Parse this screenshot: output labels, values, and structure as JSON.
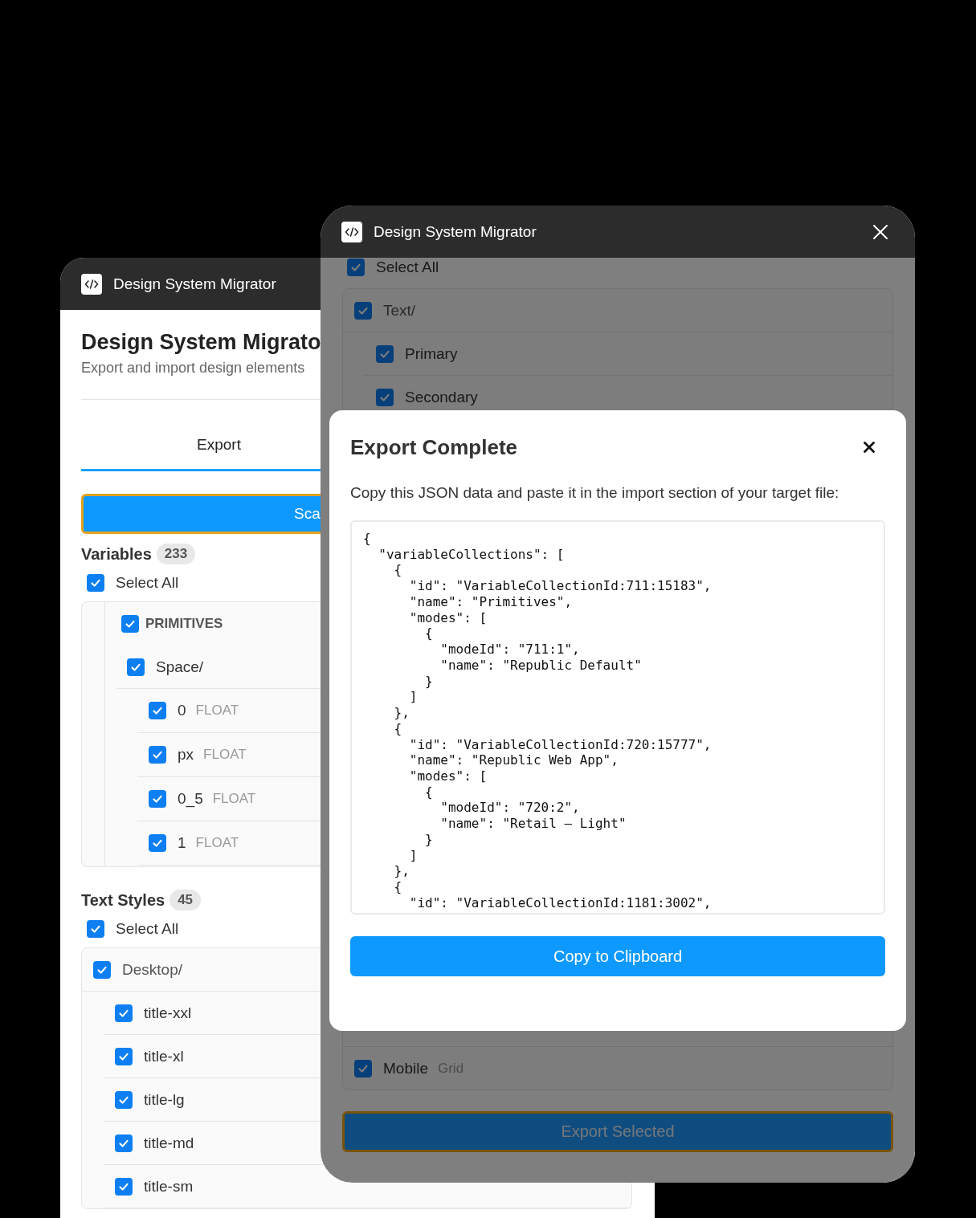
{
  "back_window": {
    "title_bar": {
      "title": "Design System Migrator"
    },
    "heading": "Design System Migrato",
    "subtitle": "Export and import design elements",
    "tabs": [
      {
        "label": "Export",
        "selected": true
      }
    ],
    "scan_button": {
      "label": "Sca"
    },
    "variables": {
      "title": "Variables",
      "count": "233",
      "select_all": {
        "label": "Select All",
        "checked": true
      },
      "tree": [
        {
          "label": "PRIMITIVES",
          "checked": true,
          "children": [
            {
              "label": "Space/",
              "checked": true,
              "children": [
                {
                  "label": "0",
                  "type": "FLOAT",
                  "checked": true
                },
                {
                  "label": "px",
                  "type": "FLOAT",
                  "checked": true
                },
                {
                  "label": "0_5",
                  "type": "FLOAT",
                  "checked": true
                },
                {
                  "label": "1",
                  "type": "FLOAT",
                  "checked": true
                }
              ]
            }
          ]
        }
      ]
    },
    "text_styles": {
      "title": "Text Styles",
      "count": "45",
      "select_all": {
        "label": "Select All",
        "checked": true
      },
      "tree": [
        {
          "label": "Desktop/",
          "checked": true,
          "children": [
            {
              "label": "title-xxl",
              "checked": true
            },
            {
              "label": "title-xl",
              "checked": true
            },
            {
              "label": "title-lg",
              "checked": true
            },
            {
              "label": "title-md",
              "checked": true
            },
            {
              "label": "title-sm",
              "checked": true
            }
          ]
        }
      ]
    }
  },
  "front_window": {
    "title_bar": {
      "title": "Design System Migrator"
    },
    "select_all": {
      "label": "Select All",
      "checked": true
    },
    "tree": [
      {
        "label": "Text/",
        "checked": true,
        "children": [
          {
            "label": "Primary",
            "checked": true
          },
          {
            "label": "Secondary",
            "checked": true
          }
        ]
      }
    ],
    "lower_items": [
      {
        "label": "Mobile",
        "type": "Grid",
        "checked": true
      }
    ],
    "export_button": {
      "label": "Export Selected"
    },
    "modal": {
      "title": "Export Complete",
      "description": "Copy this JSON data and paste it in the import section of your target file:",
      "code_lines": [
        "{",
        "  \"variableCollections\": [",
        "    {",
        "      \"id\": \"VariableCollectionId:711:15183\",",
        "      \"name\": \"Primitives\",",
        "      \"modes\": [",
        "        {",
        "          \"modeId\": \"711:1\",",
        "          \"name\": \"Republic Default\"",
        "        }",
        "      ]",
        "    },",
        "    {",
        "      \"id\": \"VariableCollectionId:720:15777\",",
        "      \"name\": \"Republic Web App\",",
        "      \"modes\": [",
        "        {",
        "          \"modeId\": \"720:2\",",
        "          \"name\": \"Retail – Light\"",
        "        }",
        "      ]",
        "    },",
        "    {",
        "      \"id\": \"VariableCollectionId:1181:3002\","
      ],
      "copy_button": {
        "label": "Copy to Clipboard"
      }
    }
  }
}
